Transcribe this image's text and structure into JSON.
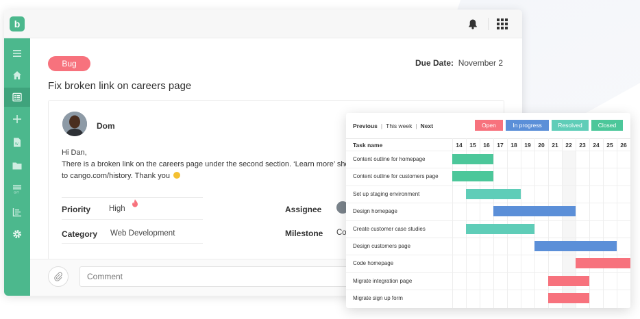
{
  "colors": {
    "brand": "#4cb88d",
    "bug": "#f7727d",
    "open": "#f7727d",
    "in_progress": "#5b8fd8",
    "resolved": "#5fcdb8",
    "closed": "#4cc79a"
  },
  "app": {
    "logo_letter": "b",
    "icons": [
      "bell-icon",
      "apps-grid-icon"
    ]
  },
  "sidebar": {
    "items": [
      {
        "icon": "menu-icon"
      },
      {
        "icon": "home-icon"
      },
      {
        "icon": "list-icon",
        "active": true
      },
      {
        "icon": "plus-icon"
      },
      {
        "icon": "document-icon"
      },
      {
        "icon": "folder-icon"
      },
      {
        "icon": "git-icon",
        "label": "GIT"
      },
      {
        "icon": "chart-icon"
      },
      {
        "icon": "gear-icon"
      }
    ]
  },
  "task": {
    "badge": "Bug",
    "due_label": "Due Date:",
    "due_value": "November 2",
    "title": "Fix broken link on careers page",
    "author": "Dom",
    "message_lines": [
      "Hi Dan,",
      "There is a broken link on the careers page under the second section. ‘Learn more’ should",
      "to cango.com/history. Thank you"
    ],
    "priority_label": "Priority",
    "priority_value": "High",
    "category_label": "Category",
    "category_value": "Web Development",
    "assignee_label": "Assignee",
    "milestone_label": "Milestone",
    "milestone_value": "Co"
  },
  "comment": {
    "placeholder": "Comment"
  },
  "gantt": {
    "nav": {
      "previous": "Previous",
      "this_week": "This week",
      "next": "Next"
    },
    "statuses": [
      {
        "label": "Open",
        "color": "#f7727d"
      },
      {
        "label": "In progress",
        "color": "#5b8fd8"
      },
      {
        "label": "Resolved",
        "color": "#5fcdb8"
      },
      {
        "label": "Closed",
        "color": "#4cc79a"
      }
    ],
    "task_header": "Task name",
    "days": [
      "14",
      "15",
      "16",
      "17",
      "18",
      "19",
      "20",
      "21",
      "22",
      "23",
      "24",
      "25",
      "26"
    ],
    "tasks": [
      {
        "name": "Content outline for homepage",
        "start": "14",
        "end": "16",
        "color": "#4cc79a"
      },
      {
        "name": "Content outline for customers page",
        "start": "14",
        "end": "16",
        "color": "#4cc79a"
      },
      {
        "name": "Set up staging environment",
        "start": "15",
        "end": "18",
        "color": "#5fcdb8"
      },
      {
        "name": "Design homepage",
        "start": "17",
        "end": "22",
        "color": "#5b8fd8"
      },
      {
        "name": "Create customer case studies",
        "start": "15",
        "end": "19",
        "color": "#5fcdb8"
      },
      {
        "name": "Design customers page",
        "start": "20",
        "end": "25",
        "color": "#5b8fd8"
      },
      {
        "name": "Code homepage",
        "start": "23",
        "end": "26",
        "color": "#f7727d"
      },
      {
        "name": "Migrate integration page",
        "start": "21",
        "end": "23",
        "color": "#f7727d"
      },
      {
        "name": "Migrate sign up form",
        "start": "21",
        "end": "23",
        "color": "#f7727d"
      }
    ]
  }
}
